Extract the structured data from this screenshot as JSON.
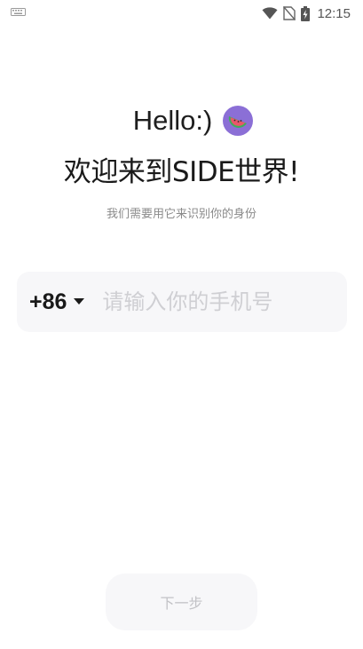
{
  "status_bar": {
    "time": "12:15",
    "icons": [
      "keyboard-icon",
      "wifi-icon",
      "no-sim-icon",
      "battery-charging-icon"
    ]
  },
  "greeting": {
    "hello": "Hello:)",
    "emoji_icon": "watermelon-icon",
    "title": "欢迎来到SIDE世界!",
    "subtitle": "我们需要用它来识别你的身份"
  },
  "phone": {
    "country_code": "+86",
    "placeholder": "请输入你的手机号",
    "value": ""
  },
  "actions": {
    "next_label": "下一步"
  },
  "colors": {
    "melon_bg": "#8b6fd6",
    "input_bg": "#f7f7f9",
    "placeholder": "#cfcfd3",
    "disabled_text": "#c2c2c6"
  }
}
